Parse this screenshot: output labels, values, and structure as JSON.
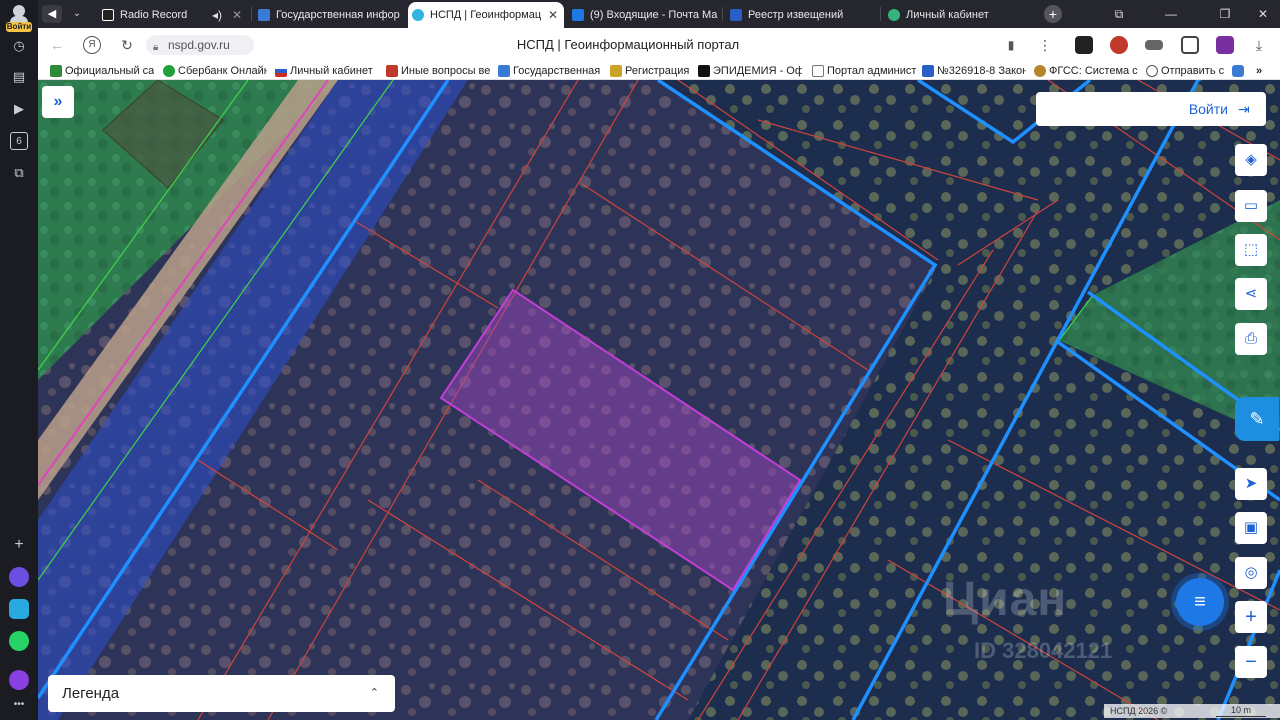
{
  "sidebar": {
    "profile_badge": "Войти",
    "counter": "6"
  },
  "tabs": [
    {
      "label": "Radio Record",
      "favicon_color": "#ffffff"
    },
    {
      "label": "Государственная инфор",
      "favicon_color": "#3a7bd5"
    },
    {
      "label": "НСПД | Геоинформац",
      "favicon_color": "#2fb5e0",
      "active": true
    },
    {
      "label": "(9) Входящие - Почта Ma",
      "favicon_color": "#1e78e6"
    },
    {
      "label": "Реестр извещений",
      "favicon_color": "#2a5fc9"
    },
    {
      "label": "Личный кабинет",
      "favicon_color": "#36b37e"
    }
  ],
  "address": {
    "url": "nspd.gov.ru",
    "title": "НСПД | Геоинформационный портал"
  },
  "bookmarks": [
    {
      "label": "Официальный са",
      "color": "#2e8b3a"
    },
    {
      "label": "Сбербанк Онлайн",
      "color": "#21a038"
    },
    {
      "label": "Личный кабинет",
      "color": "#d52b1e"
    },
    {
      "label": "Иные вопросы ве",
      "color": "#c0392b"
    },
    {
      "label": "Государственная",
      "color": "#3a7bd5"
    },
    {
      "label": "Регистрация",
      "color": "#c9a227"
    },
    {
      "label": "ЭПИДЕМИЯ - Оф",
      "color": "#111111"
    },
    {
      "label": "Портал админист",
      "color": "#777777"
    },
    {
      "label": "№326918-8 Закон",
      "color": "#2a5fc9"
    },
    {
      "label": "ФГСС: Система с",
      "color": "#b8862a"
    },
    {
      "label": "Отправить с",
      "color": "#555555"
    }
  ],
  "map": {
    "login_label": "Войти",
    "legend_label": "Легенда",
    "watermark": "Циан",
    "watermark_id": "ID 328042121",
    "copyright": "НСПД 2026 ©",
    "scale": "10 m",
    "colors": {
      "boundary_blue": "#1e90ff",
      "parcel_red": "#d0443a",
      "selected_parcel": "#c23fd6",
      "zone_green": "#3fd64a",
      "zone_pink": "#e045c0"
    }
  },
  "tools": [
    {
      "name": "layers-icon",
      "glyph": "◈"
    },
    {
      "name": "ruler-icon",
      "glyph": "▭"
    },
    {
      "name": "select-area-icon",
      "glyph": "⬚"
    },
    {
      "name": "share-icon",
      "glyph": "⋖"
    },
    {
      "name": "print-icon",
      "glyph": "⎙"
    },
    {
      "name": "navigate-icon",
      "glyph": "➤"
    },
    {
      "name": "minimap-icon",
      "glyph": "▣"
    },
    {
      "name": "locate-icon",
      "glyph": "◎"
    },
    {
      "name": "zoom-in-icon",
      "glyph": "+"
    },
    {
      "name": "zoom-out-icon",
      "glyph": "−"
    }
  ]
}
